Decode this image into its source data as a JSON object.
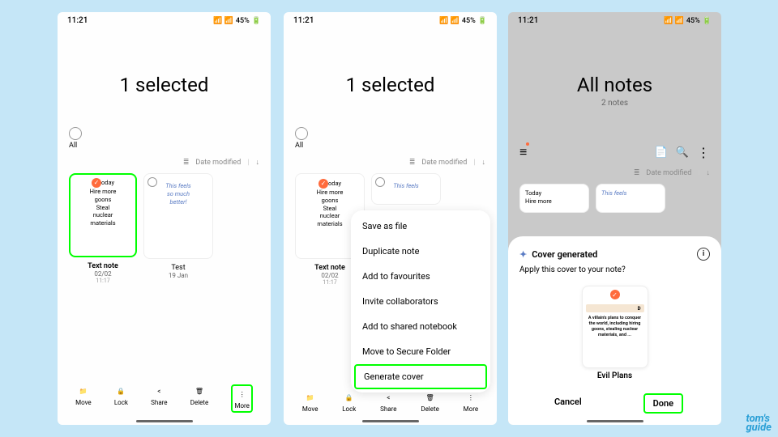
{
  "status": {
    "time": "11:21",
    "battery": "45%"
  },
  "f1": {
    "title": "1 selected",
    "all": "All",
    "sort": "Date modified",
    "card1": {
      "line1": "oday",
      "body": "Hire more\ngoons\nSteal\nnuclear\nmaterials",
      "label": "Text note",
      "date": "02/02",
      "time": "11:17"
    },
    "card2": {
      "body": "This feels\nso much\nbetter!",
      "label": "Test",
      "date": "19 Jan"
    }
  },
  "bar": {
    "move": "Move",
    "lock": "Lock",
    "share": "Share",
    "delete": "Delete",
    "more": "More"
  },
  "menu": {
    "i1": "Save as file",
    "i2": "Duplicate note",
    "i3": "Add to favourites",
    "i4": "Invite collaborators",
    "i5": "Add to shared notebook",
    "i6": "Move to Secure Folder",
    "i7": "Generate cover"
  },
  "f3": {
    "title": "All notes",
    "sub": "2 notes",
    "sort": "Date modified",
    "c1": "Today\nHire more",
    "c2": "This feels"
  },
  "sheet": {
    "hdr": "Cover generated",
    "text": "Apply this cover to your note?",
    "coverletter": "D",
    "covertext": "A villain's plans to conquer the world, including hiring goons, stealing nuclear materials, and ...",
    "coverlabel": "Evil Plans",
    "cancel": "Cancel",
    "done": "Done"
  },
  "logo": {
    "l1": "tom's",
    "l2": "guide"
  }
}
